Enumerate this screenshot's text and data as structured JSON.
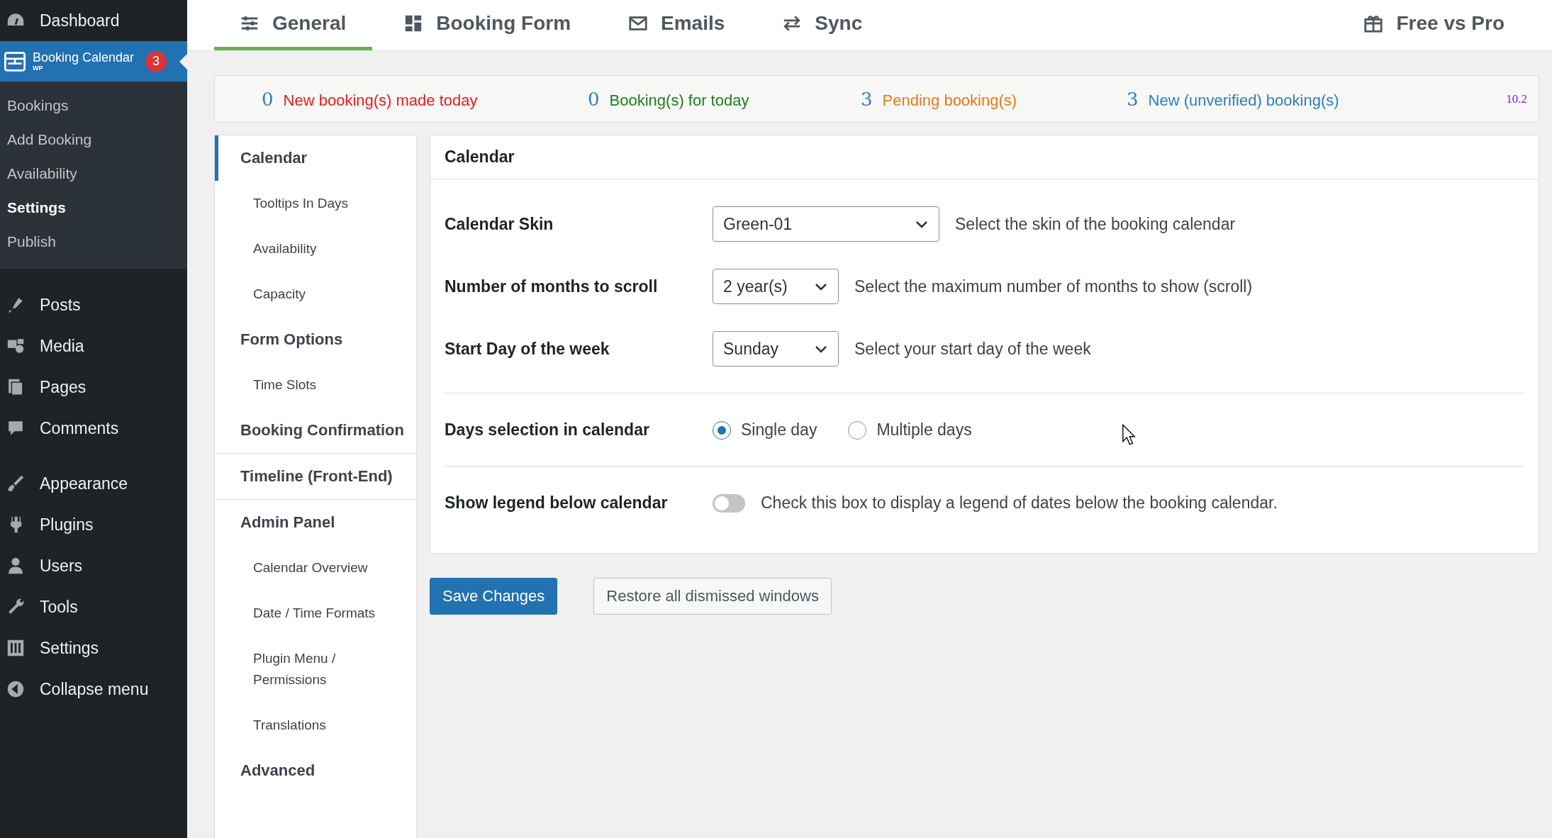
{
  "sidebar": {
    "top_item": {
      "label": "Dashboard"
    },
    "plugin_item": {
      "label": "Booking Calendar",
      "sublabel": "WP",
      "badge": "3",
      "selected": true
    },
    "submenu": [
      {
        "label": "Bookings",
        "selected": false
      },
      {
        "label": "Add Booking",
        "selected": false
      },
      {
        "label": "Availability",
        "selected": false
      },
      {
        "label": "Settings",
        "selected": true
      },
      {
        "label": "Publish",
        "selected": false
      }
    ],
    "menu_groups": [
      [
        {
          "label": "Posts"
        },
        {
          "label": "Media"
        },
        {
          "label": "Pages"
        },
        {
          "label": "Comments"
        }
      ],
      [
        {
          "label": "Appearance"
        },
        {
          "label": "Plugins"
        },
        {
          "label": "Users"
        },
        {
          "label": "Tools"
        },
        {
          "label": "Settings"
        },
        {
          "label": "Collapse menu"
        }
      ]
    ]
  },
  "tabs": [
    {
      "label": "General",
      "selected": true
    },
    {
      "label": "Booking Form",
      "selected": false
    },
    {
      "label": "Emails",
      "selected": false
    },
    {
      "label": "Sync",
      "selected": false
    }
  ],
  "right_tab": {
    "label": "Free vs Pro"
  },
  "stats": [
    {
      "count": "0",
      "label": "New booking(s) made today",
      "color": "#e0201f"
    },
    {
      "count": "0",
      "label": "Booking(s) for today",
      "color": "#1e7f1e"
    },
    {
      "count": "3",
      "label": "Pending booking(s)",
      "color": "#e5791a"
    },
    {
      "count": "3",
      "label": "New (unverified) booking(s)",
      "color": "#2c7fbf"
    }
  ],
  "version": "10.2",
  "nav": [
    {
      "label": "Calendar",
      "kind": "section",
      "selected": true,
      "divider_after": false
    },
    {
      "label": "Tooltips In Days",
      "kind": "sub",
      "selected": false,
      "divider_after": false
    },
    {
      "label": "Availability",
      "kind": "sub",
      "selected": false,
      "divider_after": false
    },
    {
      "label": "Capacity",
      "kind": "sub",
      "selected": false,
      "divider_after": false
    },
    {
      "label": "Form Options",
      "kind": "section",
      "selected": false,
      "divider_after": false
    },
    {
      "label": "Time Slots",
      "kind": "sub",
      "selected": false,
      "divider_after": false
    },
    {
      "label": "Booking Confirmation",
      "kind": "section",
      "selected": false,
      "divider_after": true
    },
    {
      "label": "Timeline (Front-End)",
      "kind": "section",
      "selected": false,
      "divider_after": true
    },
    {
      "label": "Admin Panel",
      "kind": "section",
      "selected": false,
      "divider_after": false
    },
    {
      "label": "Calendar Overview",
      "kind": "sub",
      "selected": false,
      "divider_after": false
    },
    {
      "label": "Date / Time Formats",
      "kind": "sub",
      "selected": false,
      "divider_after": false
    },
    {
      "label": "Plugin Menu / Permissions",
      "kind": "sub",
      "selected": false,
      "divider_after": false
    },
    {
      "label": "Translations",
      "kind": "sub",
      "selected": false,
      "divider_after": false
    },
    {
      "label": "Advanced",
      "kind": "section",
      "selected": false,
      "divider_after": false
    }
  ],
  "panel": {
    "title": "Calendar",
    "groups": [
      [
        {
          "kind": "select",
          "label": "Calendar Skin",
          "value": "Green-01",
          "description": "Select the skin of the booking calendar"
        },
        {
          "kind": "select",
          "label": "Number of months to scroll",
          "value": "2 year(s)",
          "description": "Select the maximum number of months to show (scroll)"
        },
        {
          "kind": "select",
          "label": "Start Day of the week",
          "value": "Sunday",
          "description": "Select your start day of the week"
        }
      ],
      [
        {
          "kind": "radio",
          "label": "Days selection in calendar",
          "options": [
            {
              "label": "Single day",
              "selected": true
            },
            {
              "label": "Multiple days",
              "selected": false
            }
          ]
        }
      ],
      [
        {
          "kind": "toggle",
          "label": "Show legend below calendar",
          "on": false,
          "description": "Check this box to display a legend of dates below the booking calendar."
        }
      ]
    ]
  },
  "buttons": [
    {
      "label": "Save Changes",
      "kind": "primary"
    },
    {
      "label": "Restore all dismissed windows",
      "kind": "secondary"
    }
  ]
}
